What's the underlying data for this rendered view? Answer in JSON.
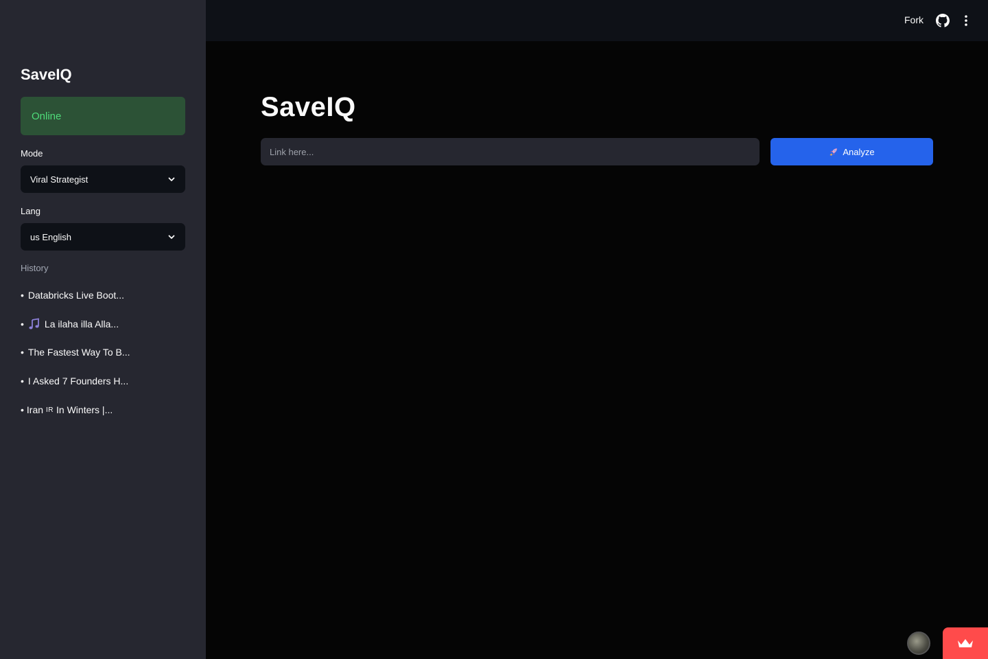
{
  "sidebar": {
    "title": "SaveIQ",
    "status": "Online",
    "mode": {
      "label": "Mode",
      "selected": "Viral Strategist"
    },
    "lang": {
      "label": "Lang",
      "selected": "us English"
    },
    "history_label": "History",
    "history": [
      {
        "bullet": "•",
        "icon": "",
        "text": "Databricks Live Boot..."
      },
      {
        "bullet": "•",
        "icon": "music-notes-icon",
        "text": "La ilaha illa Alla..."
      },
      {
        "bullet": "•",
        "icon": "",
        "text": "The Fastest Way To B..."
      },
      {
        "bullet": "•",
        "icon": "",
        "text": "I Asked 7 Founders H..."
      },
      {
        "bullet": "•",
        "icon": "",
        "text_pre": "Iran",
        "text_flag": "IR",
        "text_post": "In Winters |..."
      }
    ]
  },
  "header": {
    "fork_label": "Fork",
    "github_icon": "github-icon",
    "menu_icon": "kebab-menu-icon"
  },
  "main": {
    "title": "SaveIQ",
    "url_placeholder": "Link here...",
    "url_value": "",
    "analyze_label": "Analyze",
    "analyze_icon": "rocket-icon"
  },
  "colors": {
    "sidebar_bg": "#262730",
    "main_bg": "#050505",
    "topbar_bg": "#0e1117",
    "status_bg": "#2c5236",
    "status_text": "#4fdc7a",
    "accent": "#2563eb",
    "badge_red": "#ff4b4b"
  }
}
